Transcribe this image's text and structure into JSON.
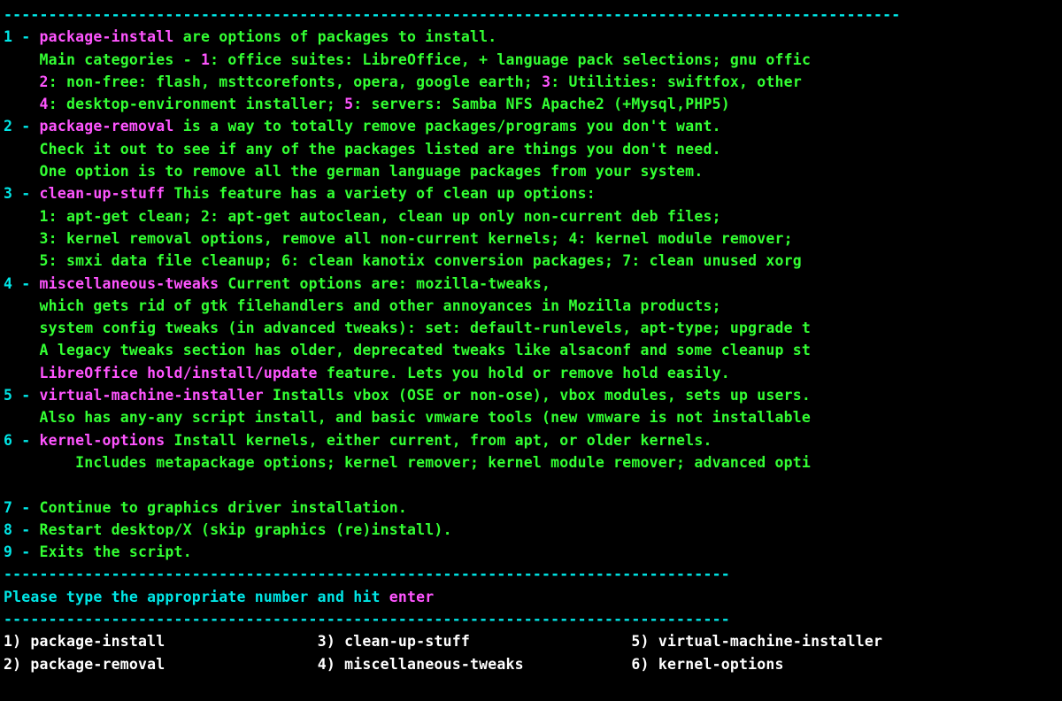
{
  "colors": {
    "cyan": "#00e6e6",
    "magenta": "#ff55ff",
    "green": "#33ff33",
    "white": "#ffffff",
    "background": "#000000"
  },
  "divider_top": "----------------------------------------------------------------------------------------------------",
  "indent": "    ",
  "items": [
    {
      "num": "1",
      "dash": " - ",
      "title": "package-install",
      "title_suffix": " are options of packages to install.",
      "lines": [
        [
          {
            "c": "gn",
            "t": "Main categories - "
          },
          {
            "c": "mg",
            "t": "1"
          },
          {
            "c": "gn",
            "t": ": office suites: LibreOffice, + language pack selections; gnu offic"
          }
        ],
        [
          {
            "c": "mg",
            "t": "2"
          },
          {
            "c": "gn",
            "t": ": non-free: flash, msttcorefonts, opera, google earth; "
          },
          {
            "c": "mg",
            "t": "3"
          },
          {
            "c": "gn",
            "t": ": Utilities: swiftfox, other"
          }
        ],
        [
          {
            "c": "mg",
            "t": "4"
          },
          {
            "c": "gn",
            "t": ": desktop-environment installer; "
          },
          {
            "c": "mg",
            "t": "5"
          },
          {
            "c": "gn",
            "t": ": servers: Samba NFS Apache2 (+Mysql,PHP5)"
          }
        ]
      ]
    },
    {
      "num": "2",
      "dash": " - ",
      "title": "package-removal",
      "title_suffix": " is a way to totally remove packages/programs you don't want.",
      "lines": [
        [
          {
            "c": "gn",
            "t": "Check it out to see if any of the packages listed are things you don't need."
          }
        ],
        [
          {
            "c": "gn",
            "t": "One option is to remove all the german language packages from your system."
          }
        ]
      ]
    },
    {
      "num": "3",
      "dash": " - ",
      "title": "clean-up-stuff",
      "title_suffix": " This feature has a variety of clean up options:",
      "lines": [
        [
          {
            "c": "gn",
            "t": "1: apt-get clean; 2: apt-get autoclean, clean up only non-current deb files;"
          }
        ],
        [
          {
            "c": "gn",
            "t": "3: kernel removal options, remove all non-current kernels; 4: kernel module remover;"
          }
        ],
        [
          {
            "c": "gn",
            "t": "5: smxi data file cleanup; 6: clean kanotix conversion packages; 7: clean unused xorg"
          }
        ]
      ]
    },
    {
      "num": "4",
      "dash": " - ",
      "title": "miscellaneous-tweaks",
      "title_suffix": " Current options are: mozilla-tweaks,",
      "lines": [
        [
          {
            "c": "gn",
            "t": "which gets rid of gtk filehandlers and other annoyances in Mozilla products;"
          }
        ],
        [
          {
            "c": "gn",
            "t": "system config tweaks (in advanced tweaks): set: default-runlevels, apt-type; upgrade t"
          }
        ],
        [
          {
            "c": "gn",
            "t": "A legacy tweaks section has older, deprecated tweaks like alsaconf and some cleanup st"
          }
        ],
        [
          {
            "c": "mg",
            "t": "LibreOffice hold/install/update"
          },
          {
            "c": "gn",
            "t": " feature. Lets you hold or remove hold easily."
          }
        ]
      ]
    },
    {
      "num": "5",
      "dash": " - ",
      "title": "virtual-machine-installer",
      "title_suffix": " Installs vbox (OSE or non-ose), vbox modules, sets up users.",
      "lines": [
        [
          {
            "c": "gn",
            "t": "Also has any-any script install, and basic vmware tools (new vmware is not installable"
          }
        ]
      ]
    },
    {
      "num": "6",
      "dash": " - ",
      "title": "kernel-options",
      "title_suffix": " Install kernels, either current, from apt, or older kernels.",
      "lines": [
        [
          {
            "c": "gn",
            "t": "    Includes metapackage options; kernel remover; kernel module remover; advanced opti"
          }
        ]
      ]
    }
  ],
  "blank_line": "",
  "simple_items": [
    {
      "num": "7",
      "dash": " - ",
      "text": "Continue to graphics driver installation."
    },
    {
      "num": "8",
      "dash": " - ",
      "text": "Restart desktop/X (skip graphics (re)install)."
    },
    {
      "num": "9",
      "dash": " - ",
      "text": "Exits the script."
    }
  ],
  "divider_bottom": "---------------------------------------------------------------------------------",
  "prompt_pre": "Please type the appropriate number and hit ",
  "prompt_key": "enter",
  "divider_bottom2": "---------------------------------------------------------------------------------",
  "options_row1": {
    "a_num": "1) ",
    "a_text": "package-install",
    "b_num": "3) ",
    "b_text": "clean-up-stuff",
    "c_num": "5) ",
    "c_text": "virtual-machine-installer"
  },
  "options_row2": {
    "a_num": "2) ",
    "a_text": "package-removal",
    "b_num": "4) ",
    "b_text": "miscellaneous-tweaks",
    "c_num": "6) ",
    "c_text": "kernel-options"
  },
  "col_widths": {
    "a": 35,
    "b": 35
  }
}
